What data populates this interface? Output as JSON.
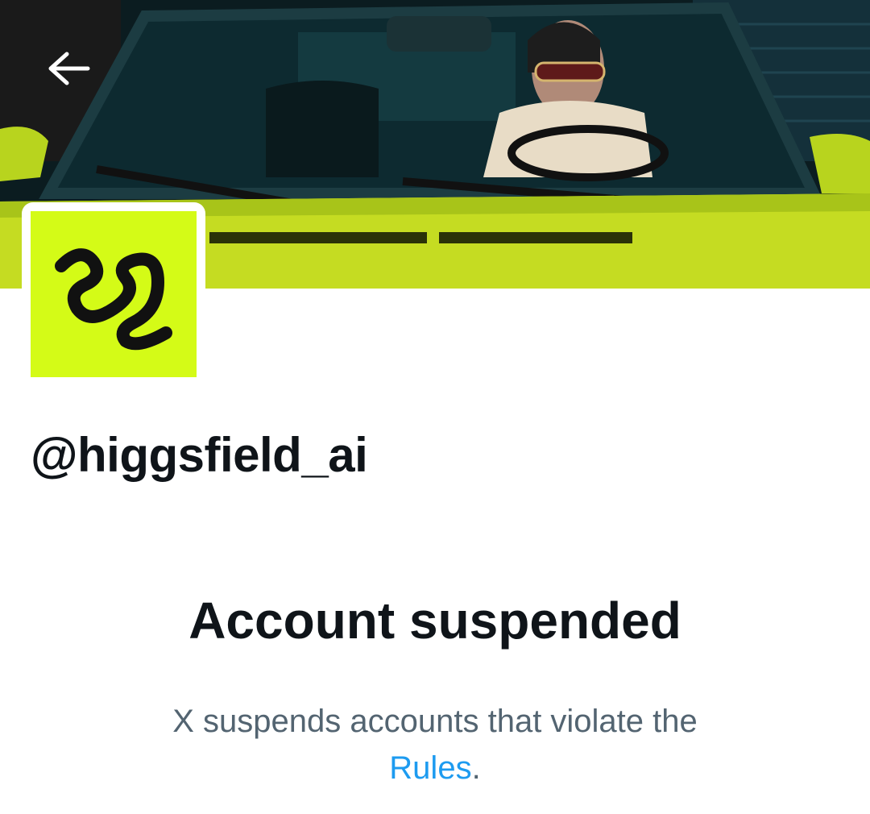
{
  "header": {
    "back_icon": "arrow-left-icon"
  },
  "banner": {
    "description_icon": "banner-image"
  },
  "profile": {
    "avatar_icon": "higgsfield-logo",
    "avatar_color": "#d4fb17",
    "handle": "@higgsfield_ai"
  },
  "notice": {
    "title": "Account suspended",
    "description": "X suspends accounts that violate the",
    "link_label": "Rules",
    "period": ".",
    "link_color": "#1d9bf0"
  }
}
